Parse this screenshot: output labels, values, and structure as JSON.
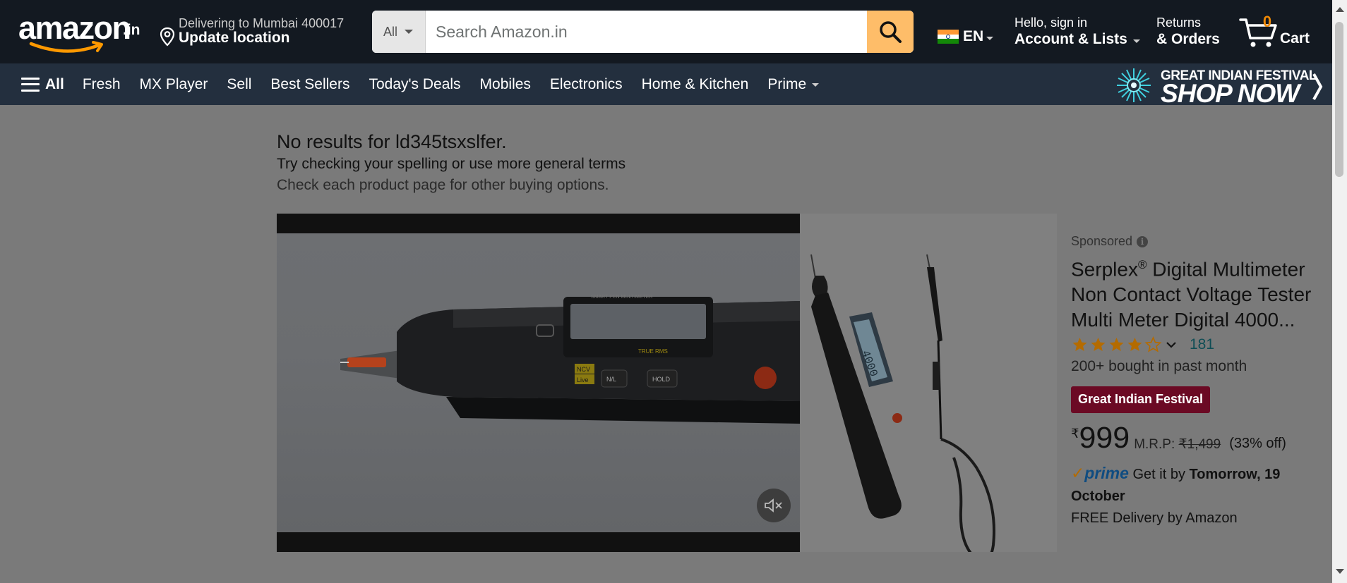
{
  "header": {
    "logo": {
      "text": "amazon",
      "suffix": ".in"
    },
    "deliver": {
      "line1": "Delivering to Mumbai 400017",
      "line2": "Update location",
      "icon": "location-pin-icon"
    },
    "search": {
      "category": "All",
      "placeholder": "Search Amazon.in",
      "value": "",
      "button_icon": "search-icon"
    },
    "language": {
      "code": "EN",
      "flag": "india-flag-icon"
    },
    "account": {
      "line1": "Hello, sign in",
      "line2": "Account & Lists"
    },
    "returns": {
      "line1": "Returns",
      "line2": "& Orders"
    },
    "cart": {
      "count": "0",
      "label": "Cart",
      "icon": "cart-icon"
    }
  },
  "subnav": {
    "all_label": "All",
    "links": [
      "Fresh",
      "MX Player",
      "Sell",
      "Best Sellers",
      "Today's Deals",
      "Mobiles",
      "Electronics",
      "Home & Kitchen",
      "Prime"
    ],
    "promo": {
      "line1": "GREAT INDIAN FESTIVAL",
      "line2": "SHOP NOW"
    }
  },
  "results": {
    "title": "No results for ld345tsxslfer.",
    "line1": "Try checking your spelling or use more general terms",
    "line2": "Check each product page for other buying options."
  },
  "ad": {
    "sponsored": "Sponsored",
    "title_brand": "Serplex",
    "title_reg": "®",
    "title_rest": " Digital Multimeter Non Contact Voltage Tester Multi Meter Digital 4000...",
    "rating": 4.0,
    "rating_count": "181",
    "bought": "200+ bought in past month",
    "badge": "Great Indian Festival",
    "price_symbol": "₹",
    "price": "999",
    "mrp_label": "M.R.P:",
    "mrp_value": "₹1,499",
    "discount": "(33% off)",
    "prime_label": "prime",
    "delivery_prefix": " Get it by ",
    "delivery_date": "Tomorrow, 19 October",
    "free_delivery": "FREE Delivery by Amazon",
    "device_text": {
      "pen_label": "SMART PEN MULTIMETER",
      "true_rms": "TRUE RMS",
      "ncv": "NCV",
      "live": "Live",
      "nl": "N/L",
      "hold": "HOLD",
      "display": "4000"
    }
  },
  "colors": {
    "nav_top": "#131921",
    "nav_bottom": "#232f3e",
    "search_button": "#febd69",
    "cart_count": "#f08804",
    "badge": "#6b0a24",
    "overlay": "#7a7a7a"
  }
}
